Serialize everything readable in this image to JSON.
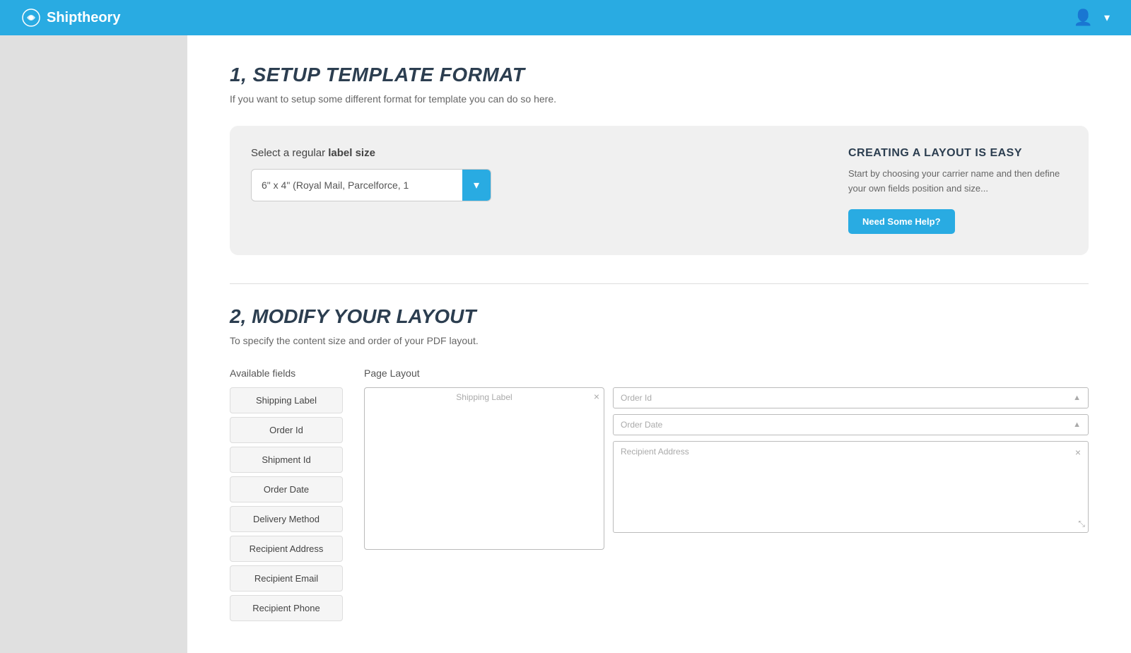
{
  "header": {
    "logo_text": "Shiptheory",
    "user_icon": "👤",
    "chevron_icon": "▾"
  },
  "section1": {
    "title": "1, SETUP TEMPLATE FORMAT",
    "description": "If you want to setup some different format for template you can do so here.",
    "select_label_prefix": "Select a regular ",
    "select_label_strong": "label size",
    "select_value": "6\" x 4\" (Royal Mail, Parcelforce, 1",
    "help_title": "CREATING A LAYOUT IS EASY",
    "help_text": "Start by choosing your carrier name and then define your own fields position and size...",
    "help_button": "Need Some Help?"
  },
  "section2": {
    "title": "2, MODIFY YOUR LAYOUT",
    "description": "To specify the content size and order of your PDF layout.",
    "available_fields_label": "Available fields",
    "page_layout_label": "Page Layout",
    "fields": [
      "Shipping Label",
      "Order Id",
      "Shipment Id",
      "Order Date",
      "Delivery Method",
      "Recipient Address",
      "Recipient Email",
      "Recipient Phone"
    ],
    "page_layout": {
      "shipping_label": {
        "title": "Shipping Label",
        "close": "×"
      },
      "right_fields": [
        {
          "label": "Order Id",
          "type": "small",
          "icon": "▲"
        },
        {
          "label": "Order Date",
          "type": "small",
          "icon": "▲"
        },
        {
          "label": "Recipient Address",
          "type": "large",
          "close": "×"
        }
      ]
    }
  }
}
